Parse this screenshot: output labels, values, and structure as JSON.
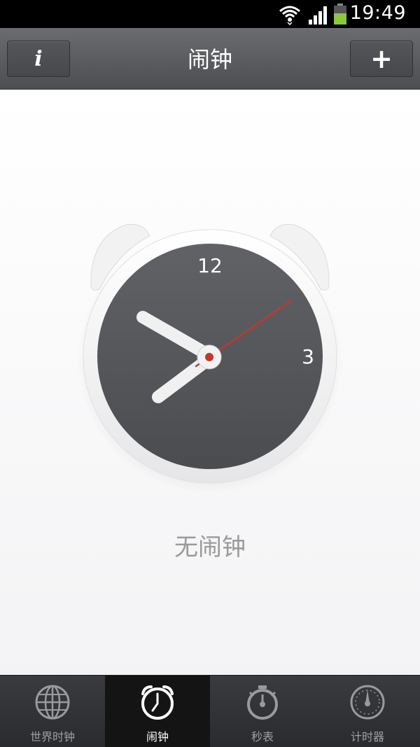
{
  "status_bar": {
    "time": "19:49",
    "icons": [
      "wifi-icon",
      "signal-icon",
      "battery-icon"
    ]
  },
  "title_bar": {
    "title": "闹钟",
    "info_label": "i",
    "add_label": "+"
  },
  "clock": {
    "numerals": [
      "12",
      "3"
    ],
    "hour_hand_color": "#f0f0f0",
    "second_hand_color": "#c0392b",
    "face_color": "#56585c"
  },
  "main": {
    "empty_text": "无闹钟"
  },
  "tabs": [
    {
      "label": "世界时钟",
      "icon": "globe-icon",
      "active": false
    },
    {
      "label": "闹钟",
      "icon": "alarm-clock-icon",
      "active": true
    },
    {
      "label": "秒表",
      "icon": "stopwatch-icon",
      "active": false
    },
    {
      "label": "计时器",
      "icon": "timer-icon",
      "active": false
    }
  ]
}
